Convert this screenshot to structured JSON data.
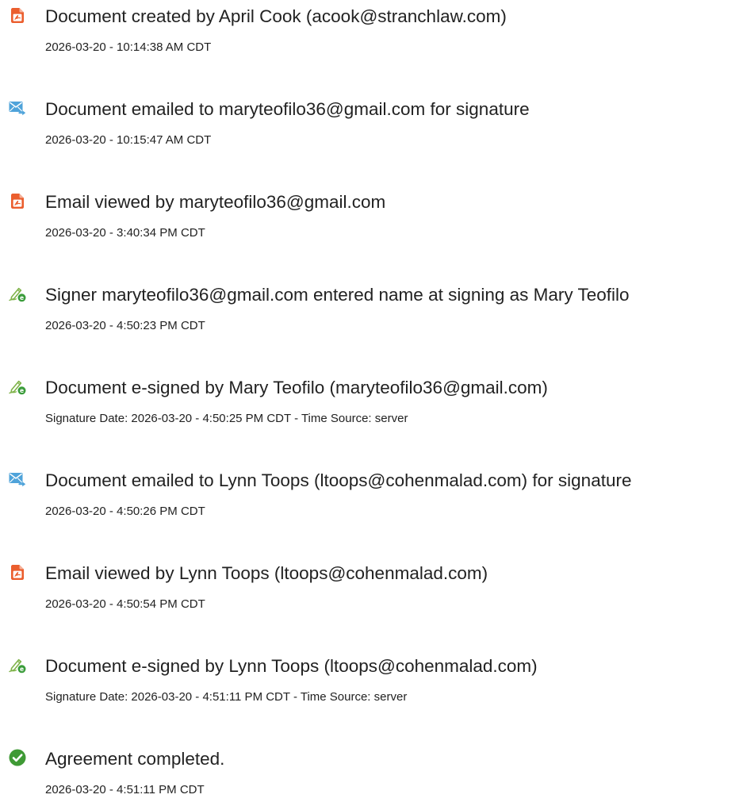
{
  "colors": {
    "doc_icon": "#EB5E2E",
    "mail_icon": "#4FA3DA",
    "sign_icon_pen": "#7FB34A",
    "sign_icon_badge": "#3A9C3A",
    "check_icon": "#3F9A35",
    "text": "#222222"
  },
  "events": [
    {
      "icon": "document-icon",
      "title": "Document created by April Cook (acook@stranchlaw.com)",
      "meta": "2026-03-20 - 10:14:38 AM CDT"
    },
    {
      "icon": "email-send-icon",
      "title": "Document emailed to maryteofilo36@gmail.com for signature",
      "meta": "2026-03-20 - 10:15:47 AM CDT"
    },
    {
      "icon": "document-icon",
      "title": "Email viewed by maryteofilo36@gmail.com",
      "meta": "2026-03-20 - 3:40:34 PM CDT"
    },
    {
      "icon": "esign-icon",
      "title": "Signer maryteofilo36@gmail.com entered name at signing as Mary Teofilo",
      "meta": "2026-03-20 - 4:50:23 PM CDT"
    },
    {
      "icon": "esign-icon",
      "title": "Document e-signed by Mary Teofilo (maryteofilo36@gmail.com)",
      "meta": "Signature Date: 2026-03-20 - 4:50:25 PM CDT - Time Source: server"
    },
    {
      "icon": "email-send-icon",
      "title": "Document emailed to Lynn Toops (ltoops@cohenmalad.com) for signature",
      "meta": "2026-03-20 - 4:50:26 PM CDT"
    },
    {
      "icon": "document-icon",
      "title": "Email viewed by Lynn Toops (ltoops@cohenmalad.com)",
      "meta": "2026-03-20 - 4:50:54 PM CDT"
    },
    {
      "icon": "esign-icon",
      "title": "Document e-signed by Lynn Toops (ltoops@cohenmalad.com)",
      "meta": "Signature Date: 2026-03-20 - 4:51:11 PM CDT - Time Source: server"
    },
    {
      "icon": "checkmark-circle-icon",
      "title": "Agreement completed.",
      "meta": "2026-03-20 - 4:51:11 PM CDT"
    }
  ]
}
